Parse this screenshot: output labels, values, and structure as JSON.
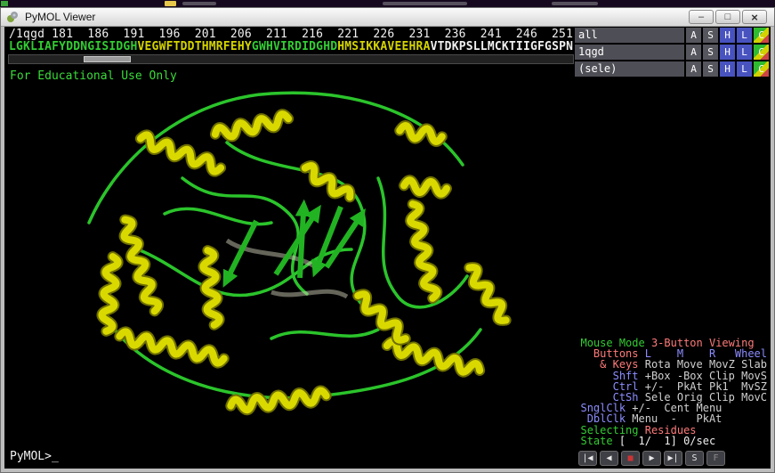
{
  "palette": {
    "green": "#33cc33",
    "yellow": "#d4d400",
    "white": "#f0f0f0",
    "salmon": "#ff7a7a",
    "blue": "#8c8cff",
    "text": "#d0d0d0"
  },
  "background_strip": {
    "icons": [
      {
        "name": "folder-icon",
        "color": "#e8c84a"
      }
    ]
  },
  "window": {
    "title": "PyMOL Viewer",
    "icon": "pymol-icon",
    "controls": [
      {
        "name": "minimize-button",
        "glyph": "–"
      },
      {
        "name": "maximize-button",
        "glyph": "□"
      },
      {
        "name": "close-button",
        "glyph": "×"
      }
    ]
  },
  "sequence": {
    "ruler": "/1qgd 181  186  191  196  201  206  211  216  221  226  231  236  241  246  251",
    "segments": [
      {
        "text": "LGKLIAFYDDNGISIDGH",
        "color": "green"
      },
      {
        "text": "VEGWFTDD",
        "color": "yellow"
      },
      {
        "text": "THMRFEHY",
        "color": "yellow"
      },
      {
        "text": "GWHVIRDIDGHD",
        "color": "green"
      },
      {
        "text": "HMSIKKAVEEHRA",
        "color": "yellow"
      },
      {
        "text": "VTDKPSLLMCKTIIGFGSPN",
        "color": "white"
      }
    ],
    "scrollbar": {
      "thumb_left_pct": 13.2,
      "thumb_width_pct": 8.4
    }
  },
  "watermark": "For Educational Use Only",
  "object_panel": {
    "rows": [
      {
        "name": "all",
        "buttons": [
          "A",
          "S",
          "H",
          "L",
          "C"
        ]
      },
      {
        "name": "1qgd",
        "buttons": [
          "A",
          "S",
          "H",
          "L",
          "C"
        ]
      },
      {
        "name": "(sele)",
        "buttons": [
          "A",
          "S",
          "H",
          "L",
          "C"
        ]
      }
    ]
  },
  "mouse_panel": {
    "lines": [
      [
        {
          "t": "Mouse Mode ",
          "c": "green"
        },
        {
          "t": "3-Button Viewing",
          "c": "salmon"
        }
      ],
      [
        {
          "t": "  Buttons ",
          "c": "salmon"
        },
        {
          "t": "L    M    R   Wheel",
          "c": "blue"
        }
      ],
      [
        {
          "t": "   & Keys ",
          "c": "salmon"
        },
        {
          "t": "Rota Move MovZ Slab",
          "c": "text"
        }
      ],
      [
        {
          "t": "     Shft ",
          "c": "blue"
        },
        {
          "t": "+Box -Box Clip MovS",
          "c": "text"
        }
      ],
      [
        {
          "t": "     Ctrl ",
          "c": "blue"
        },
        {
          "t": "+/-  PkAt Pk1  MvSZ",
          "c": "text"
        }
      ],
      [
        {
          "t": "     CtSh ",
          "c": "blue"
        },
        {
          "t": "Sele Orig Clip MovC",
          "c": "text"
        }
      ],
      [
        {
          "t": "SnglClk ",
          "c": "blue"
        },
        {
          "t": "+/-  Cent Menu",
          "c": "text"
        }
      ],
      [
        {
          "t": " DblClk ",
          "c": "blue"
        },
        {
          "t": "Menu  -   PkAt",
          "c": "text"
        }
      ],
      [
        {
          "t": "Selecting ",
          "c": "green"
        },
        {
          "t": "Residues",
          "c": "salmon"
        }
      ],
      [
        {
          "t": "State ",
          "c": "green"
        },
        {
          "t": "[  1/  1] 0/sec",
          "c": "white"
        }
      ]
    ]
  },
  "command_line": {
    "prompt": "PyMOL>",
    "cursor": "_"
  },
  "vcr": {
    "buttons": [
      {
        "name": "go-to-start-button",
        "glyph": "|◀"
      },
      {
        "name": "step-back-button",
        "glyph": "◀"
      },
      {
        "name": "stop-button",
        "glyph": "■",
        "color": "#cc3434"
      },
      {
        "name": "play-button",
        "glyph": "▶"
      },
      {
        "name": "go-to-end-button",
        "glyph": "▶|"
      },
      {
        "name": "sequence-toggle-button",
        "glyph": "S"
      },
      {
        "name": "fullscreen-button",
        "glyph": "F",
        "color": "#8a8a8a"
      }
    ]
  }
}
